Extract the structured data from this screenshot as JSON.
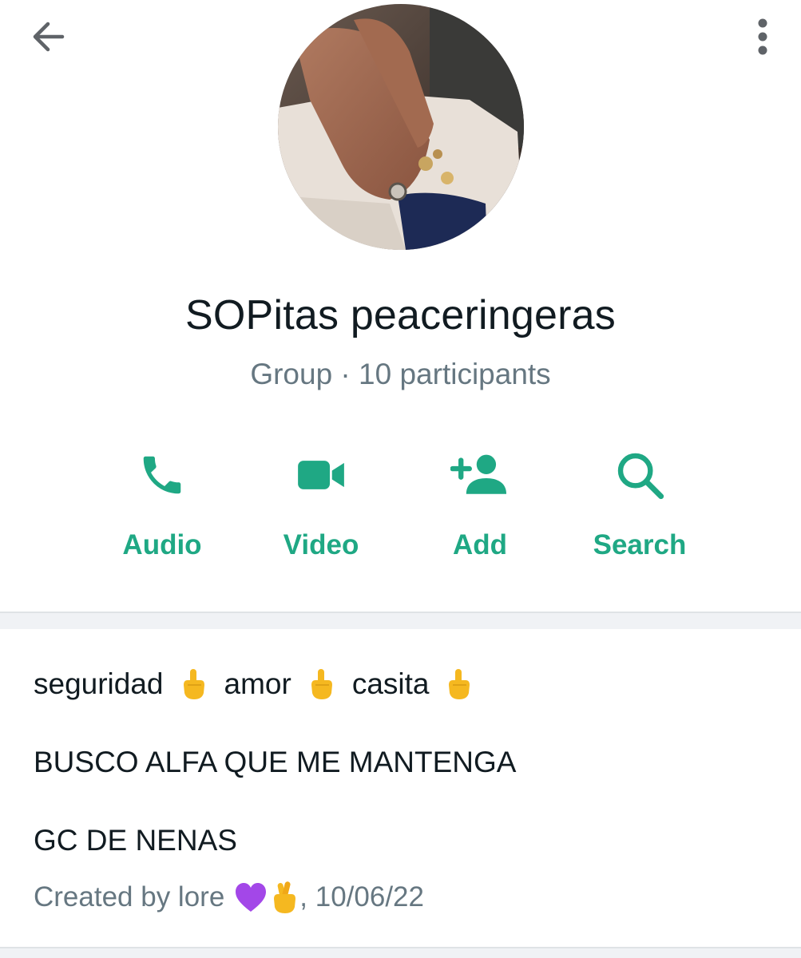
{
  "header": {
    "back_icon": "arrow-left-icon",
    "more_icon": "more-vertical-icon"
  },
  "group": {
    "name": "SOPitas peaceringeras",
    "subtitle": "Group · 10 participants"
  },
  "actions": [
    {
      "icon": "phone-icon",
      "label": "Audio"
    },
    {
      "icon": "video-camera-icon",
      "label": "Video"
    },
    {
      "icon": "add-person-icon",
      "label": "Add"
    },
    {
      "icon": "search-icon",
      "label": "Search"
    }
  ],
  "description": {
    "line1": {
      "w1": "seguridad",
      "w2": "amor",
      "w3": "casita"
    },
    "line2": "BUSCO ALFA QUE ME MANTENGA",
    "line3": "GC DE NENAS",
    "created_prefix": "Created by lore",
    "created_suffix": ", 10/06/22"
  },
  "colors": {
    "accent": "#1fa884",
    "text": "#111b21",
    "muted": "#667781",
    "divider": "#f0f2f5"
  }
}
